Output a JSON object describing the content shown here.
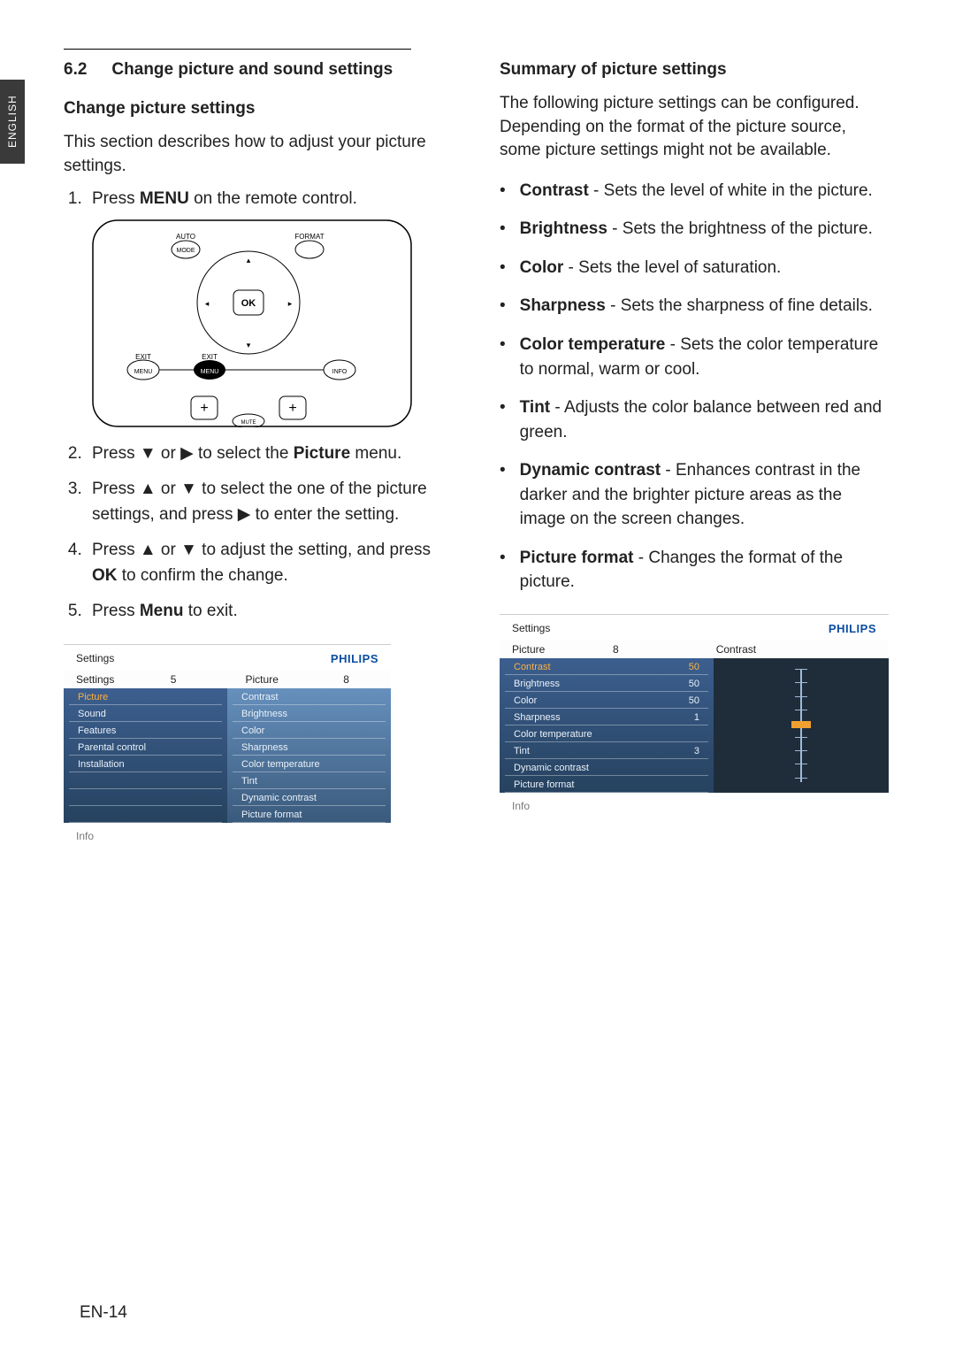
{
  "side_tab": "ENGLISH",
  "page_number": "EN-14",
  "section_number": "6.2",
  "section_title": "Change picture and sound settings",
  "left": {
    "sub1": "Change picture settings",
    "intro": "This section describes how to adjust your picture settings.",
    "steps": {
      "s1_a": "Press ",
      "s1_b": "MENU",
      "s1_c": " on the remote control.",
      "s2_a": "Press ▼ or ▶ to select the ",
      "s2_b": "Picture",
      "s2_c": " menu.",
      "s3": "Press ▲ or ▼ to select the one of the picture settings, and press ▶ to enter the setting.",
      "s4_a": "Press ▲ or ▼ to adjust the setting, and press ",
      "s4_b": "OK",
      "s4_c": " to confirm the change.",
      "s5_a": "Press ",
      "s5_b": "Menu",
      "s5_c": " to exit."
    },
    "remote": {
      "auto": "AUTO",
      "mode": "MODE",
      "format": "FORMAT",
      "ok": "OK",
      "exit_l": "EXIT",
      "exit_m": "EXIT",
      "menu_l": "MENU",
      "menu_m": "MENU",
      "info": "INFO",
      "plus_l": "+",
      "plus_r": "+",
      "mute": "MUTE"
    },
    "osd": {
      "brand": "PHILIPS",
      "head_l": "Settings",
      "head_n1": "5",
      "head_r": "Picture",
      "head_n2": "8",
      "colA": [
        "Picture",
        "Sound",
        "Features",
        "Parental control",
        "Installation"
      ],
      "colA_sel": "Picture",
      "colB": [
        "Contrast",
        "Brightness",
        "Color",
        "Sharpness",
        "Color temperature",
        "Tint",
        "Dynamic contrast",
        "Picture format"
      ],
      "info": "Info"
    }
  },
  "right": {
    "sub": "Summary of picture settings",
    "intro": "The following picture settings can be configured. Depending on the format of the picture source, some picture settings might not be available.",
    "defs": [
      {
        "t": "Contrast",
        "d": " - Sets the level of white in the picture."
      },
      {
        "t": "Brightness",
        "d": " - Sets the brightness of the picture."
      },
      {
        "t": "Color",
        "d": " - Sets the level of saturation."
      },
      {
        "t": "Sharpness",
        "d": " - Sets the sharpness of fine details."
      },
      {
        "t": "Color temperature",
        "d": " - Sets the color temperature to normal, warm or cool."
      },
      {
        "t": "Tint",
        "d": " - Adjusts the color balance between red and green."
      },
      {
        "t": "Dynamic contrast",
        "d": " - Enhances contrast in the darker and the brighter picture areas as the image on the screen changes."
      },
      {
        "t": "Picture format",
        "d": " - Changes the format of the picture."
      }
    ],
    "osd": {
      "brand": "PHILIPS",
      "head_l": "Settings",
      "crumb_l": "Picture",
      "crumb_n": "8",
      "crumb_r": "Contrast",
      "items": [
        {
          "n": "Contrast",
          "v": "50",
          "sel": true
        },
        {
          "n": "Brightness",
          "v": "50"
        },
        {
          "n": "Color",
          "v": "50"
        },
        {
          "n": "Sharpness",
          "v": "1"
        },
        {
          "n": "Color temperature",
          "v": ""
        },
        {
          "n": "Tint",
          "v": "3"
        },
        {
          "n": "Dynamic contrast",
          "v": ""
        },
        {
          "n": "Picture format",
          "v": ""
        }
      ],
      "info": "Info"
    }
  }
}
